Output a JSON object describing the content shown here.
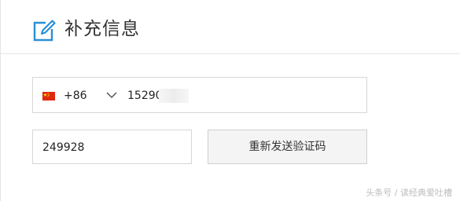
{
  "header": {
    "title": "补充信息",
    "icon": "edit-icon"
  },
  "phone": {
    "country_flag": "china-flag-icon",
    "country_code": "+86",
    "number_visible": "15290      652",
    "number_prefix": "15290",
    "number_suffix": "652"
  },
  "verification": {
    "code_value": "249928",
    "resend_label": "重新发送验证码"
  },
  "watermark": "头条号 / 读经典爱吐槽",
  "colors": {
    "accent": "#2a8fd6",
    "border": "#d7d7d7",
    "button_bg": "#f4f4f4",
    "flag_red": "#de2910",
    "flag_yellow": "#ffde00"
  }
}
